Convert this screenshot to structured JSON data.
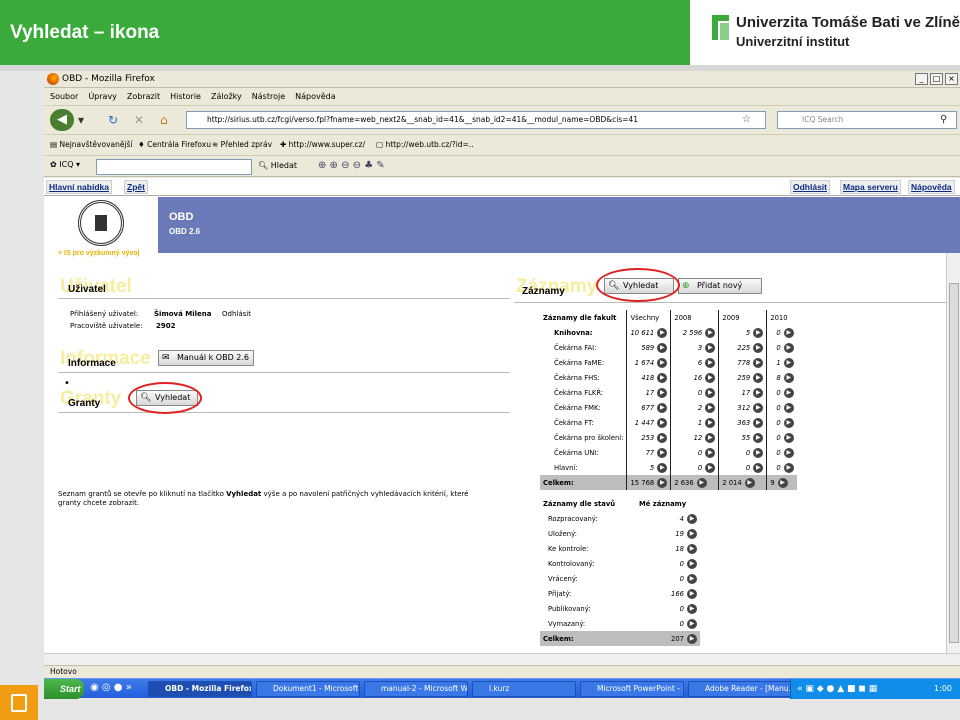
{
  "slide": {
    "title": "Vyhledat – ikona",
    "logo_line1": "Univerzita Tomáše Bati ve Zlíně",
    "logo_line2": "Univerzitní institut"
  },
  "window": {
    "title": "OBD - Mozilla Firefox",
    "controls": [
      "_",
      "□",
      "×"
    ]
  },
  "menu": [
    "Soubor",
    "Úpravy",
    "Zobrazit",
    "Historie",
    "Záložky",
    "Nástroje",
    "Nápověda"
  ],
  "nav": {
    "url": "http://sirius.utb.cz/fcgi/verso.fpl?fname=web_next2&__snab_id=41&__snab_id2=41&__modul_name=OBD&cis=41",
    "search_placeholder": "ICQ Search"
  },
  "bookmarks": [
    "Nejnavštěvovanější",
    "Centrála Firefoxu",
    "Přehled zpráv",
    "http://www.super.cz/",
    "http://web.utb.cz/?id=.."
  ],
  "icq_toolbar": {
    "label": "ICQ",
    "search_label": "Hledat"
  },
  "obd_nav": {
    "left": [
      "Hlavní nabídka",
      "Zpět"
    ],
    "right": [
      "Odhlásit",
      "Mapa serveru",
      "Nápověda"
    ]
  },
  "banner": {
    "title": "OBD",
    "version": "OBD 2.6",
    "subline": "> IS pro výzkumný vývoj"
  },
  "ghost_titles": {
    "user": "Uživatel",
    "info": "Informace",
    "grants": "Granty",
    "records": "Záznamy"
  },
  "user_section": {
    "title": "Uživatel",
    "logged_label": "Přihlášený uživatel:",
    "logged_value": "Šimová Milena",
    "logout": "Odhlásit",
    "workplace_label": "Pracoviště uživatele:",
    "workplace_value": "2902"
  },
  "info_section": {
    "title": "Informace",
    "manual_button": "Manuál k OBD 2.6",
    "bullet": "•"
  },
  "grants_section": {
    "title": "Granty",
    "search_button": "Vyhledat",
    "description_pre": "Seznam grantů se otevře po kliknutí na tlačítko ",
    "description_bold": "Vyhledat",
    "description_post": " výše a po navolení patřičných vyhledávacích kritérií, které granty chcete zobrazit."
  },
  "records_section": {
    "title": "Záznamy",
    "search_button": "Vyhledat",
    "add_button": "Přidat nový"
  },
  "faculty_table": {
    "headers": [
      "Záznamy dle fakult",
      "Všechny",
      "2008",
      "2009",
      "2010"
    ],
    "rows": [
      {
        "label": "Knihovna:",
        "bold": true,
        "values": [
          "10 611",
          "2 596",
          "5",
          "0"
        ]
      },
      {
        "label": "Čekárna FAI:",
        "values": [
          "589",
          "3",
          "225",
          "0"
        ]
      },
      {
        "label": "Čekárna FaME:",
        "values": [
          "1 674",
          "6",
          "778",
          "1"
        ]
      },
      {
        "label": "Čekárna FHS:",
        "values": [
          "418",
          "16",
          "259",
          "8"
        ]
      },
      {
        "label": "Čekárna FLKŘ:",
        "values": [
          "17",
          "0",
          "17",
          "0"
        ]
      },
      {
        "label": "Čekárna FMK:",
        "values": [
          "677",
          "2",
          "312",
          "0"
        ]
      },
      {
        "label": "Čekárna FT:",
        "values": [
          "1 447",
          "1",
          "363",
          "0"
        ]
      },
      {
        "label": "Čekárna pro školení:",
        "values": [
          "253",
          "12",
          "55",
          "0"
        ]
      },
      {
        "label": "Čekárna UNI:",
        "values": [
          "77",
          "0",
          "0",
          "0"
        ]
      },
      {
        "label": "Hlavní:",
        "values": [
          "5",
          "0",
          "0",
          "0"
        ]
      }
    ],
    "total": {
      "label": "Celkem:",
      "values": [
        "15 768",
        "2 636",
        "2 014",
        "9"
      ]
    }
  },
  "state_table": {
    "headers": [
      "Záznamy dle stavů",
      "Mé záznamy"
    ],
    "rows": [
      {
        "label": "Rozpracovaný:",
        "value": "4"
      },
      {
        "label": "Uložený:",
        "value": "19"
      },
      {
        "label": "Ke kontrole:",
        "value": "18"
      },
      {
        "label": "Kontrolovaný:",
        "value": "0"
      },
      {
        "label": "Vrácený:",
        "value": "0"
      },
      {
        "label": "Přijatý:",
        "value": "166"
      },
      {
        "label": "Publikovaný:",
        "value": "0"
      },
      {
        "label": "Vymazaný:",
        "value": "0"
      }
    ],
    "total": {
      "label": "Celkem:",
      "value": "207"
    }
  },
  "status": "Hotovo",
  "taskbar": {
    "start": "Start",
    "items": [
      "OBD - Mozilla Firefox",
      "Dokument1 - Microsoft ...",
      "manual-2 - Microsoft W...",
      "l.kurz",
      "Microsoft PowerPoint - [...",
      "Adobe Reader - [Manu..."
    ],
    "clock": "1:00"
  },
  "colors": {
    "accent_green": "#3aab3a",
    "banner_blue": "#6a79b8",
    "highlight_red": "#e02020",
    "ghost_yellow": "#f6ed9e"
  }
}
